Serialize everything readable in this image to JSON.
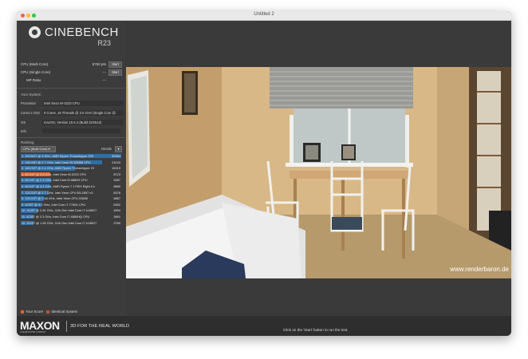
{
  "window": {
    "title": "Untitled 2"
  },
  "app": {
    "name": "CINEBENCH",
    "version": "R23"
  },
  "tests": [
    {
      "label": "CPU (Multi Core)",
      "score": "8750 pts",
      "button": "Start"
    },
    {
      "label": "CPU (Single Core)",
      "score": "---",
      "button": "Start"
    },
    {
      "label": "MP Ratio",
      "score": "---"
    }
  ],
  "system": {
    "header": "Your System",
    "fields": [
      {
        "key": "Processor",
        "value": "Intel Xeon W-3223 CPU"
      },
      {
        "key": "Cores x GHz",
        "value": "8 Cores, 16 Threads @ 3.5 GHz (Single Core @"
      },
      {
        "key": "OS",
        "value": "macOS; Version 10.6.4 (Build 22G513)"
      },
      {
        "key": "Info",
        "value": ""
      }
    ]
  },
  "ranking": {
    "header": "Ranking",
    "dropdown": "CPU (Multi Core)",
    "details_label": "Details",
    "details_btn": "▾",
    "max_value": 30054,
    "rows": [
      {
        "label": "1. 32C/64T @ 3 GHz, AMD Ryzen Threadripper 299",
        "value": "30054",
        "num": 30054,
        "you": false
      },
      {
        "label": "2. 24C/48T @ 2.7 GHz, Intel Xeon W-3265M CPU",
        "value": "24243",
        "num": 24243,
        "you": false
      },
      {
        "label": "3. 16C/32T @ 3.4 GHz, AMD Ryzen Threadripper 19",
        "value": "16315",
        "num": 16315,
        "you": false
      },
      {
        "label": "4. 8C/16T @ 3.5 GHz, Intel Xeon W-3223 CPU",
        "value": "8723",
        "num": 8723,
        "you": true
      },
      {
        "label": "5. 8C/16T @ 2.3 GHz, Intel Core i9-9880H CPU",
        "value": "9087",
        "num": 9087,
        "you": false
      },
      {
        "label": "6. 8C/16T @ 3.4 GHz, AMD Ryzen 7 1700X Eight-Co",
        "value": "8889",
        "num": 8889,
        "you": false
      },
      {
        "label": "7. 12C/24T @ 2.7 GHz, Intel Xeon CPU E5-2697 v2",
        "value": "8376",
        "num": 8376,
        "you": false
      },
      {
        "label": "8. 12C/24T @ 2.66 GHz, Intel Xeon CPU X5650",
        "value": "6867",
        "num": 6867,
        "you": false
      },
      {
        "label": "9. 4C/8T @ 4.2 GHz, Intel Core i7-7700K CPU",
        "value": "6302",
        "num": 6302,
        "you": false
      },
      {
        "label": "10. 4C/8T @ 2.81 GHz, 11th Gen Intel Core i7-1165G7",
        "value": "4904",
        "num": 4904,
        "you": false
      },
      {
        "label": "11. 4C/8T @ 2.3 GHz, Intel Core i7-4850HQ CPU",
        "value": "3891",
        "num": 3891,
        "you": false
      },
      {
        "label": "12. 4C/8T @ 1.69 GHz, 11th Gen Intel Core i7-1165G7",
        "value": "3769",
        "num": 3769,
        "you": false
      }
    ]
  },
  "legend": {
    "your_score": "Your Score",
    "identical": "Identical System"
  },
  "footer": {
    "brand": "MAXON",
    "brand_sub": "A NEMETSCHEK COMPANY",
    "tagline": "3D FOR THE REAL WORLD",
    "hint": "Click on the 'Start' button to run the test."
  },
  "render": {
    "watermark": "www.renderbaron.de"
  },
  "colors": {
    "your_score": "#e0622b",
    "identical": "#b85a2a",
    "rank_bar": "#2f6fa8"
  }
}
